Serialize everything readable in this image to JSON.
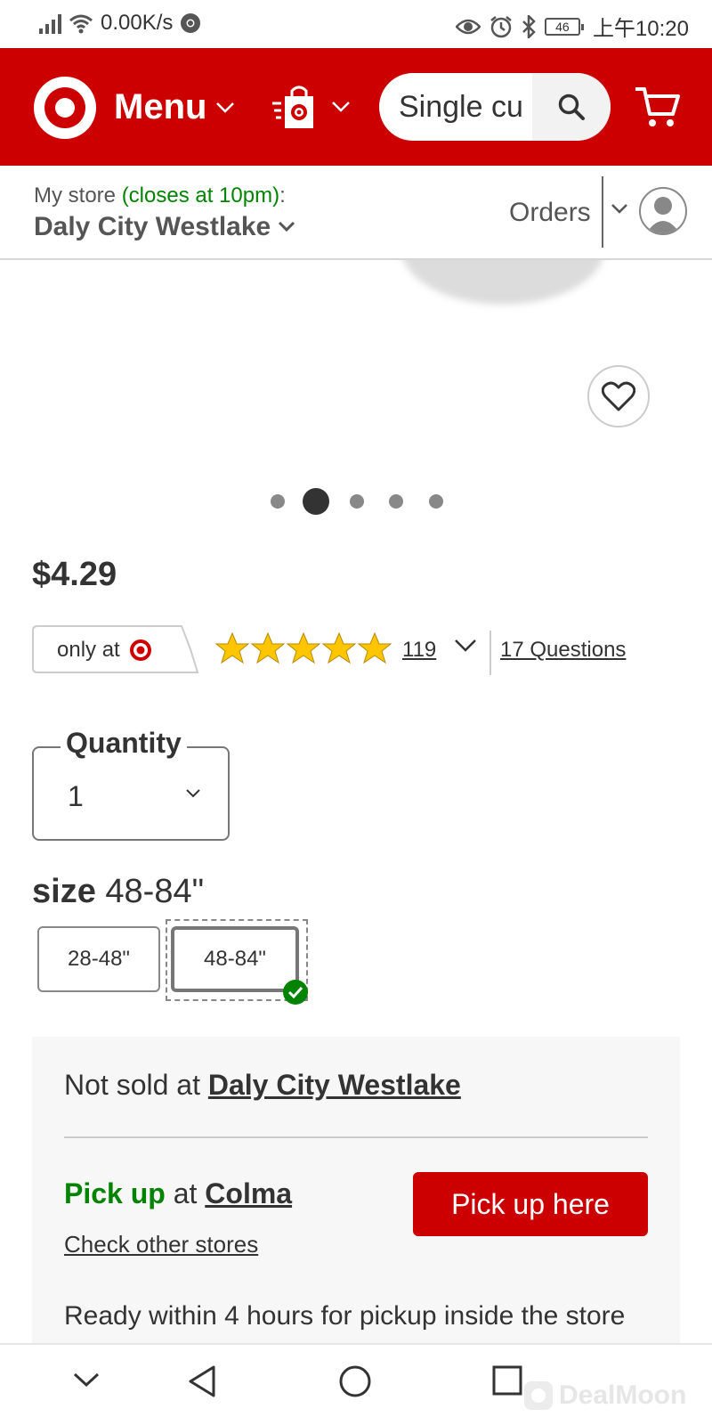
{
  "status_bar": {
    "net_speed": "0.00K/s",
    "battery": "46",
    "time": "上午10:20"
  },
  "header": {
    "menu_label": "Menu",
    "search_value": "Single cu"
  },
  "store_bar": {
    "my_store_label": "My store",
    "closes_text": "(closes at 10pm)",
    "colon": ":",
    "store_name": "Daly City Westlake",
    "orders_label": "Orders"
  },
  "gallery": {
    "total_images": 5,
    "active_index": 2
  },
  "product": {
    "price": "$4.29",
    "only_at": "only at",
    "rating": 5,
    "review_count": "119",
    "questions": "17 Questions"
  },
  "quantity": {
    "label": "Quantity",
    "value": "1"
  },
  "size": {
    "label": "size",
    "selected": "48-84\"",
    "options": [
      "28-48\"",
      "48-84\""
    ]
  },
  "fulfillment": {
    "not_sold_prefix": "Not sold at",
    "not_sold_store": "Daly City Westlake",
    "pickup_label": "Pick up",
    "pickup_at": "at",
    "pickup_store": "Colma",
    "check_other": "Check other stores",
    "pickup_button": "Pick up here",
    "ready_text": "Ready within 4 hours for pickup inside the store"
  },
  "watermark": "DealMoon",
  "colors": {
    "brand_red": "#cc0000",
    "green": "#008300",
    "text": "#333333"
  }
}
